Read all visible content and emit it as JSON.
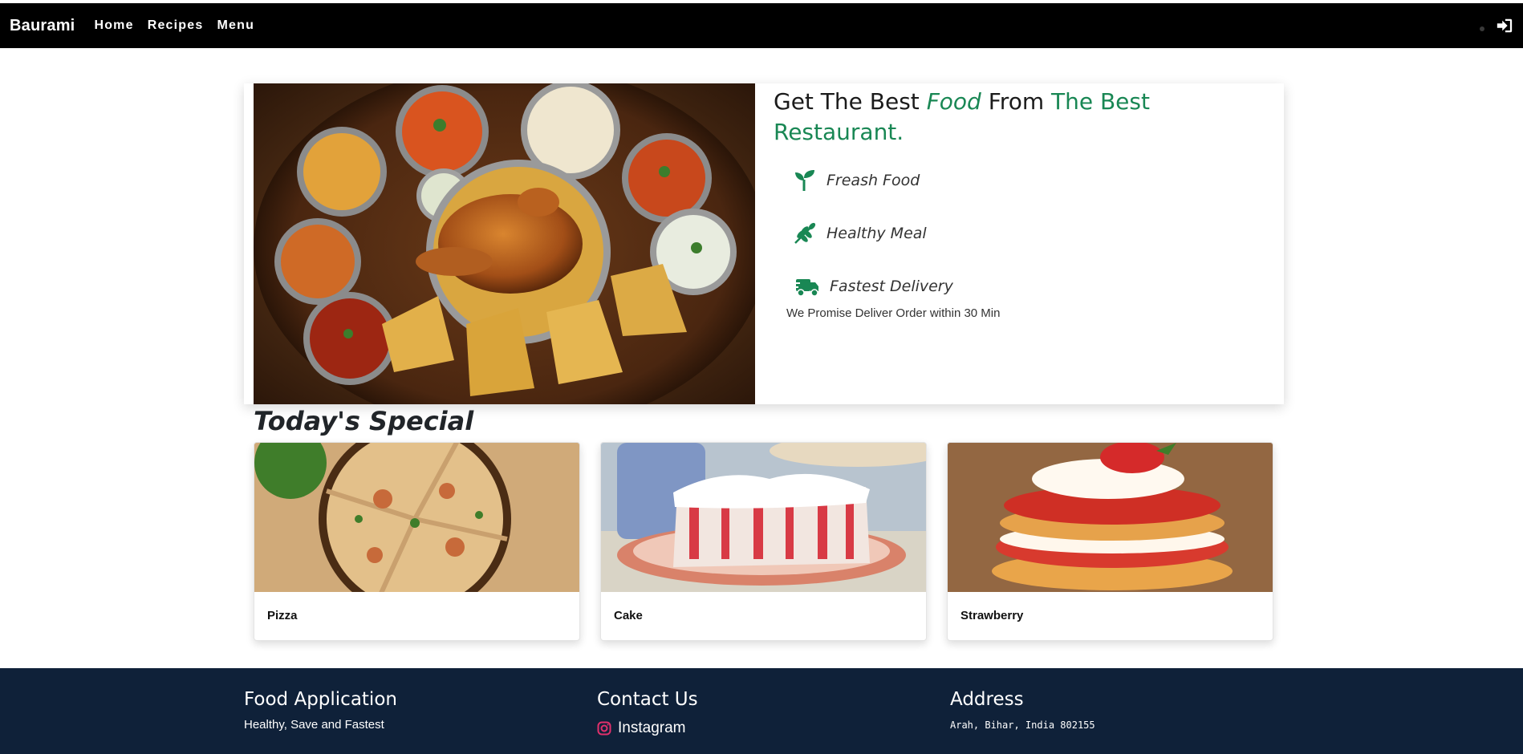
{
  "navbar": {
    "brand": "Baurami",
    "links": [
      "Home",
      "Recipes",
      "Menu"
    ],
    "login_icon": "sign-in-icon"
  },
  "hero": {
    "title_part1": "Get The Best ",
    "title_food": "Food",
    "title_part2": " From ",
    "title_part3": "The Best Restaurant.",
    "features": [
      {
        "label": "Freash Food",
        "icon": "seedling-icon"
      },
      {
        "label": "Healthy Meal",
        "icon": "wheat-icon"
      },
      {
        "label": "Fastest Delivery",
        "icon": "truck-icon"
      }
    ],
    "promise": "We Promise Deliver Order within 30 Min",
    "image": "food-platter-image"
  },
  "special": {
    "title": "Today's Special",
    "items": [
      {
        "name": "Pizza"
      },
      {
        "name": "Cake"
      },
      {
        "name": "Strawberry"
      }
    ]
  },
  "footer": {
    "about_title": "Food Application",
    "about_text": "Healthy, Save and Fastest",
    "contact_title": "Contact Us",
    "instagram": "Instagram",
    "address_title": "Address",
    "address": "Arah, Bihar, India 802155"
  },
  "colors": {
    "accent": "#198754",
    "navbar": "#000000",
    "footer": "#0f2139",
    "instagram": "#e1306c"
  }
}
